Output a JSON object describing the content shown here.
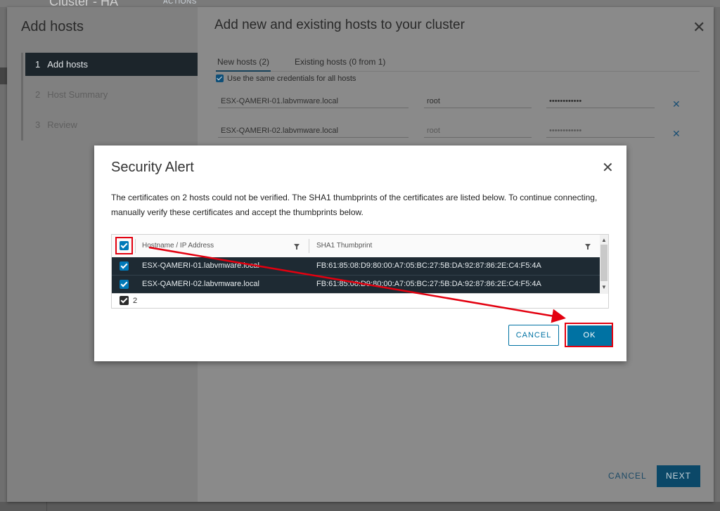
{
  "background": {
    "page_title": "Cluster - HA",
    "actions_label": "ACTIONS"
  },
  "wizard": {
    "title": "Add hosts",
    "steps": [
      {
        "num": "1",
        "label": "Add hosts"
      },
      {
        "num": "2",
        "label": "Host Summary"
      },
      {
        "num": "3",
        "label": "Review"
      }
    ],
    "main_title": "Add new and existing hosts to your cluster",
    "close_glyph": "✕",
    "tabs": [
      {
        "label": "New hosts (2)"
      },
      {
        "label": "Existing hosts (0 from 1)"
      }
    ],
    "same_credentials_label": "Use the same credentials for all hosts",
    "host_rows": [
      {
        "host": "ESX-QAMERI-01.labvmware.local",
        "user": "root",
        "password": "••••••••••••"
      },
      {
        "host": "ESX-QAMERI-02.labvmware.local",
        "user": "root",
        "password": "••••••••••••"
      }
    ],
    "remove_glyph": "✕",
    "footer": {
      "cancel": "CANCEL",
      "next": "NEXT"
    }
  },
  "modal": {
    "title": "Security Alert",
    "close_glyph": "✕",
    "body": "The certificates on 2 hosts could not be verified. The SHA1 thumbprints of the certificates are listed below. To continue connecting, manually verify these certificates and accept the thumbprints below.",
    "grid": {
      "columns": [
        "Hostname / IP Address",
        "SHA1 Thumbprint"
      ],
      "rows": [
        {
          "host": "ESX-QAMERI-01.labvmware.local",
          "thumbprint": "FB:61:85:08:D9:80:00:A7:05:BC:27:5B:DA:92:87:86:2E:C4:F5:4A"
        },
        {
          "host": "ESX-QAMERI-02.labvmware.local",
          "thumbprint": "FB:61:85:08:D9:80:00:A7:05:BC:27:5B:DA:92:87:86:2E:C4:F5:4A"
        }
      ],
      "selected_count": "2"
    },
    "buttons": {
      "cancel": "CANCEL",
      "ok": "OK"
    }
  },
  "annotation_color": "#e3000f",
  "accent_color": "#0072a3"
}
